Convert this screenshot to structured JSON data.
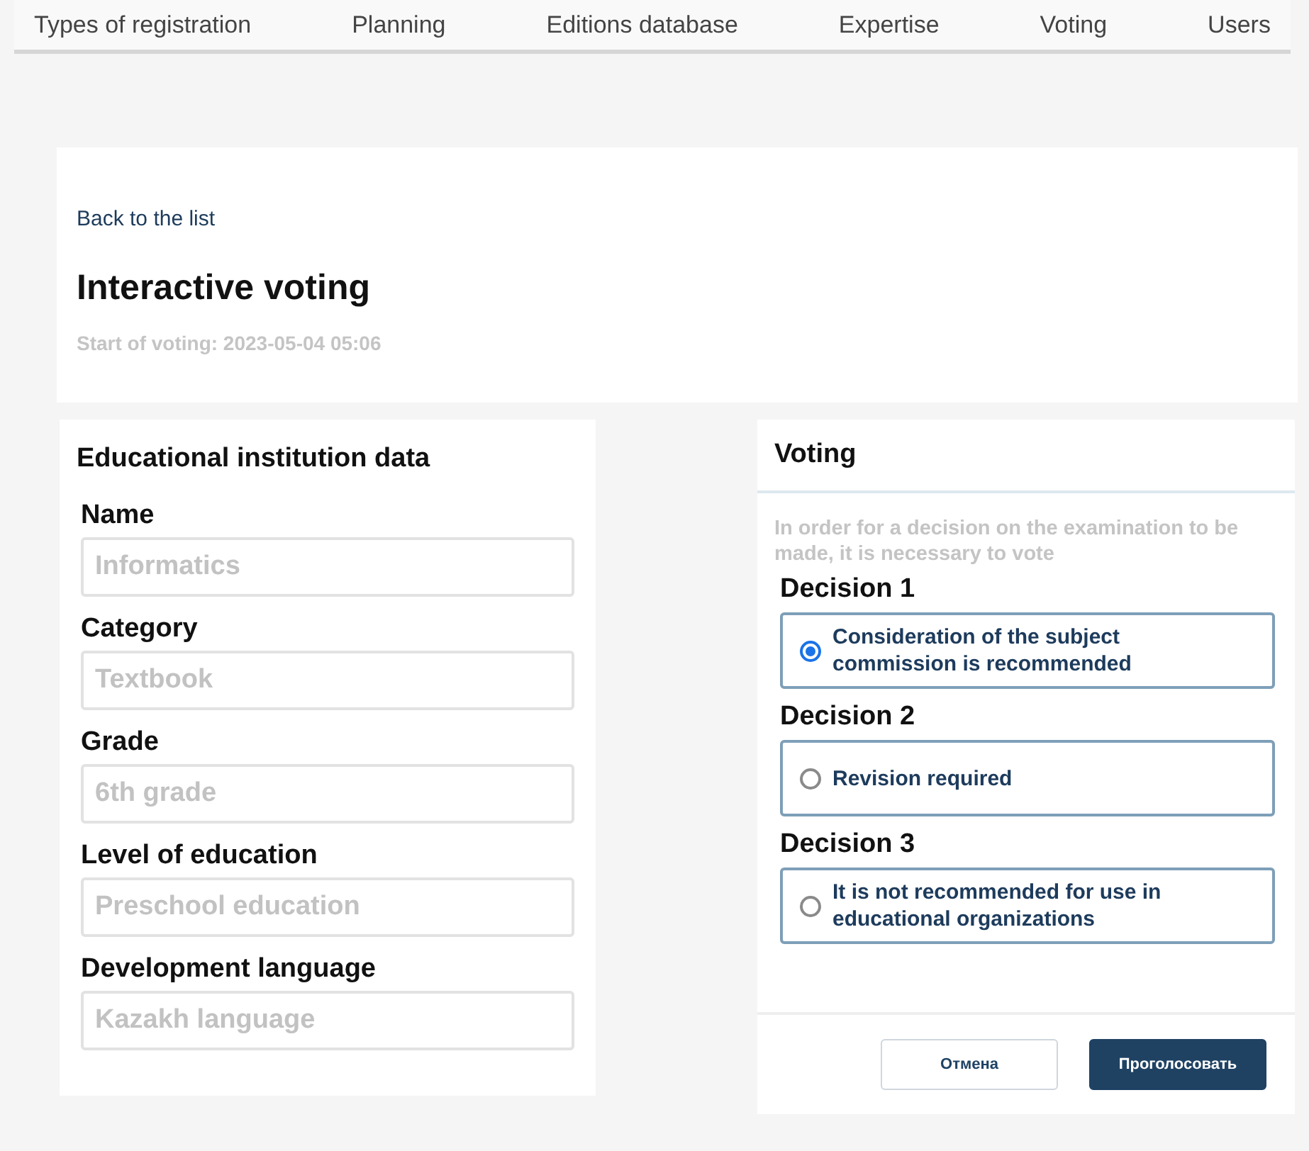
{
  "nav": [
    "Types of registration",
    "Planning",
    "Editions database",
    "Expertise",
    "Voting",
    "Users"
  ],
  "header": {
    "back_link": "Back to the list",
    "title": "Interactive voting",
    "subtitle": "Start of voting: 2023-05-04 05:06"
  },
  "institution": {
    "title": "Educational institution data",
    "fields": [
      {
        "label": "Name",
        "value": "Informatics",
        "disabled": true
      },
      {
        "label": "Category",
        "value": "Textbook",
        "disabled": true
      },
      {
        "label": "Grade",
        "value": "6th grade",
        "disabled": true
      },
      {
        "label": "Level of education",
        "value": "Preschool education",
        "disabled": true
      },
      {
        "label": "Development language",
        "value": "Kazakh language",
        "disabled": true
      }
    ]
  },
  "voting": {
    "title": "Voting",
    "hint": "In order for a decision on the examination to be made, it is necessary to vote",
    "decisions": [
      {
        "heading": "Decision 1",
        "option": "Consideration of the subject commission is recommended",
        "selected": true
      },
      {
        "heading": "Decision 2",
        "option": "Revision required",
        "selected": false
      },
      {
        "heading": "Decision 3",
        "option": "It is not recommended for use in educational organizations",
        "selected": false
      }
    ],
    "buttons": [
      {
        "label": "Отмена",
        "kind": "secondary"
      },
      {
        "label": "Проголосовать",
        "kind": "primary"
      }
    ]
  }
}
